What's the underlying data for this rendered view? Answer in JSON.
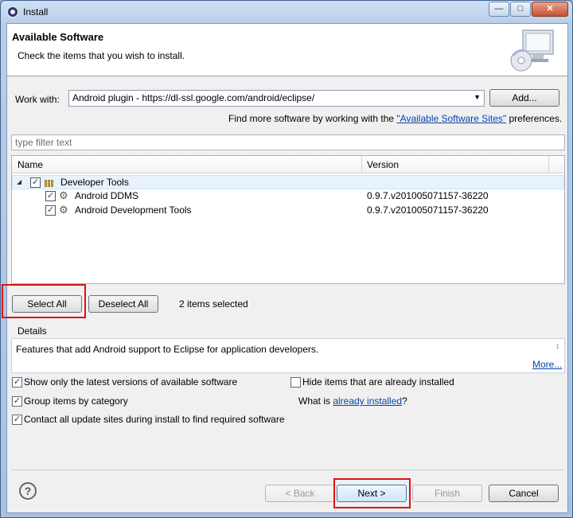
{
  "window": {
    "title": "Install"
  },
  "banner": {
    "title": "Available Software",
    "subtitle": "Check the items that you wish to install."
  },
  "work_with": {
    "label": "Work with:",
    "value": "Android plugin - https://dl-ssl.google.com/android/eclipse/",
    "add_button": "Add...",
    "find_more_prefix": "Find more software by working with the ",
    "find_more_link": "\"Available Software Sites\"",
    "find_more_suffix": " preferences."
  },
  "filter": {
    "placeholder": "type filter text"
  },
  "tree": {
    "columns": [
      "Name",
      "Version"
    ],
    "group": {
      "label": "Developer Tools",
      "checked": true
    },
    "items": [
      {
        "label": "Android DDMS",
        "version": "0.9.7.v201005071157-36220",
        "checked": true
      },
      {
        "label": "Android Development Tools",
        "version": "0.9.7.v201005071157-36220",
        "checked": true
      }
    ]
  },
  "selection": {
    "select_all": "Select All",
    "deselect_all": "Deselect All",
    "count_text": "2 items selected"
  },
  "details": {
    "label": "Details",
    "text": "Features that add Android support to Eclipse for application developers.",
    "more_link": "More..."
  },
  "options": {
    "show_latest": {
      "label": "Show only the latest versions of available software",
      "checked": true
    },
    "hide_installed": {
      "label": "Hide items that are already installed",
      "checked": false
    },
    "group_by_category": {
      "label": "Group items by category",
      "checked": true
    },
    "contact_sites": {
      "label": "Contact all update sites during install to find required software",
      "checked": true
    },
    "what_is_prefix": "What is ",
    "already_installed_link": "already installed",
    "what_is_suffix": "?"
  },
  "footer": {
    "help": "?",
    "back": "< Back",
    "next": "Next >",
    "finish": "Finish",
    "cancel": "Cancel"
  },
  "colors": {
    "highlight": "#e01010",
    "link": "#0645ad"
  }
}
